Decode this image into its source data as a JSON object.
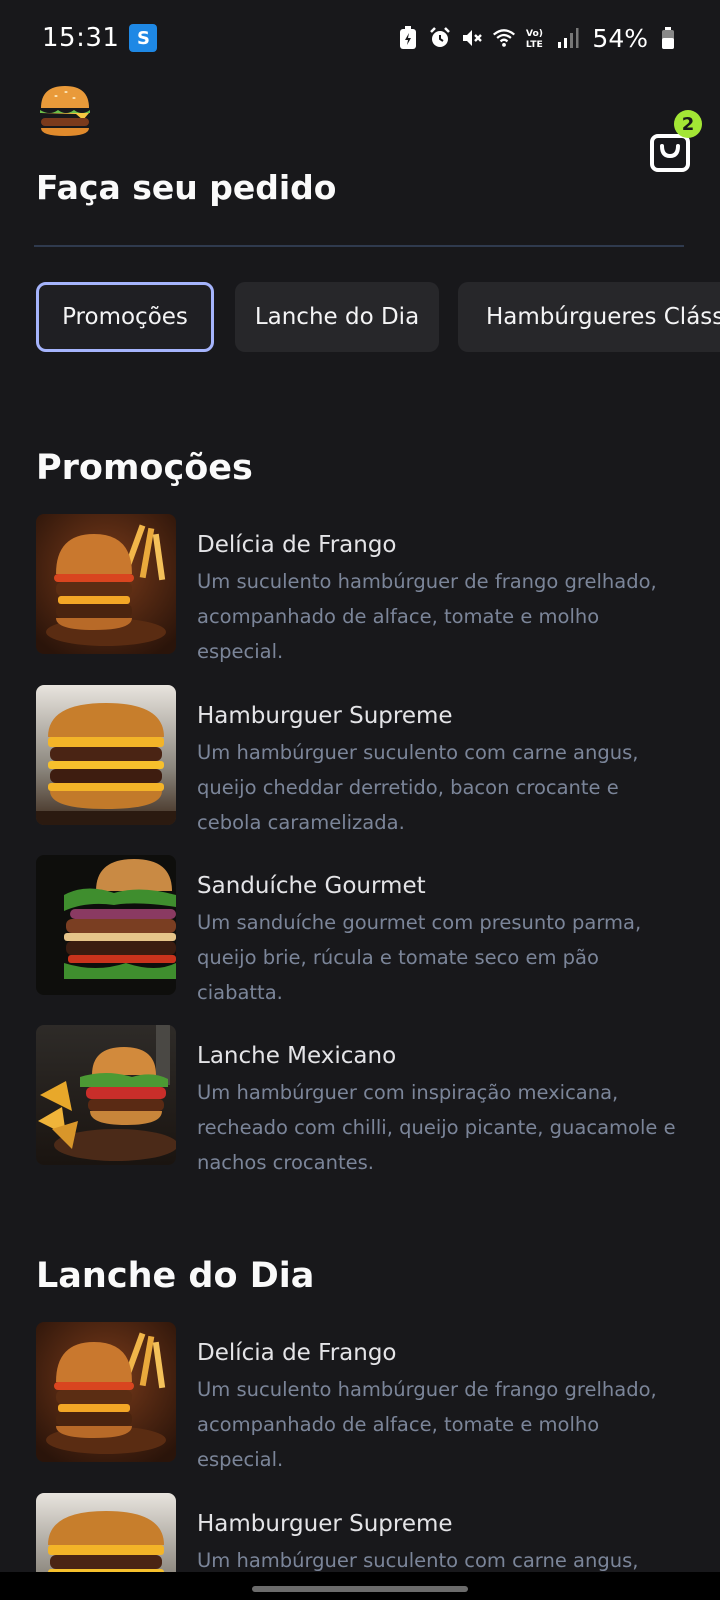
{
  "status_bar": {
    "time": "15:31",
    "battery_percent": "54%",
    "icons": [
      "battery-saver-icon",
      "alarm-icon",
      "mute-icon",
      "wifi-icon",
      "volte-icon",
      "signal-icon",
      "battery-icon"
    ]
  },
  "header": {
    "title": "Faça seu pedido",
    "cart_count": "2",
    "logo_icon": "burger-logo-icon"
  },
  "tabs": [
    {
      "label": "Promoções",
      "active": true
    },
    {
      "label": "Lanche do Dia",
      "active": false
    },
    {
      "label": "Hambúrgueres Clássicos",
      "active": false
    }
  ],
  "sections": [
    {
      "title": "Promoções",
      "items": [
        {
          "name": "Delícia de Frango",
          "description": "Um suculento hambúrguer de frango grelhado, acompanhado de alface, tomate e molho especial."
        },
        {
          "name": "Hamburguer Supreme",
          "description": "Um hambúrguer suculento com carne angus, queijo cheddar derretido, bacon crocante e cebola caramelizada."
        },
        {
          "name": "Sanduíche Gourmet",
          "description": "Um sanduíche gourmet com presunto parma, queijo brie, rúcula e tomate seco em pão ciabatta."
        },
        {
          "name": "Lanche Mexicano",
          "description": "Um hambúrguer com inspiração mexicana, recheado com chilli, queijo picante, guacamole e nachos crocantes."
        }
      ]
    },
    {
      "title": "Lanche do Dia",
      "items": [
        {
          "name": "Delícia de Frango",
          "description": "Um suculento hambúrguer de frango grelhado, acompanhado de alface, tomate e molho especial."
        },
        {
          "name": "Hamburguer Supreme",
          "description": "Um hambúrguer suculento com carne angus,"
        }
      ]
    }
  ],
  "colors": {
    "background": "#18181b",
    "accent": "#a5b4fc",
    "badge": "#a3e635",
    "muted_text": "#7b8599"
  }
}
